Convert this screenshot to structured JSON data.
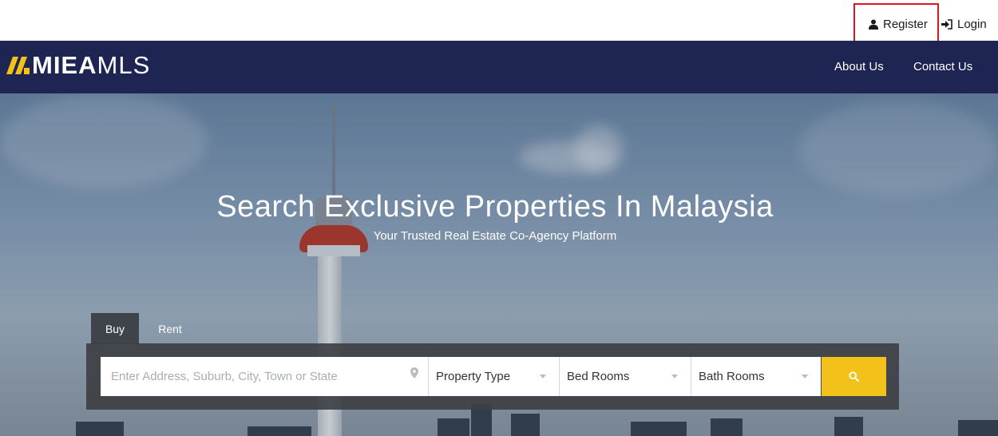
{
  "topbar": {
    "register_label": "Register",
    "login_label": "Login",
    "register_icon": "user-icon",
    "login_icon": "sign-in-icon"
  },
  "brand": {
    "name_bold": "MIEA",
    "name_thin": "MLS",
    "accent_color": "#f2c21b",
    "nav_color": "#1e2552"
  },
  "nav": {
    "about": "About Us",
    "contact": "Contact Us"
  },
  "hero": {
    "title": "Search Exclusive Properties In Malaysia",
    "subtitle": "Your Trusted Real Estate Co-Agency Platform"
  },
  "search": {
    "tabs": [
      {
        "label": "Buy",
        "active": true
      },
      {
        "label": "Rent",
        "active": false
      }
    ],
    "address_placeholder": "Enter Address, Suburb, City, Town or State",
    "property_type": "Property Type",
    "bed_rooms": "Bed Rooms",
    "bath_rooms": "Bath Rooms",
    "button_icon": "search-icon"
  }
}
